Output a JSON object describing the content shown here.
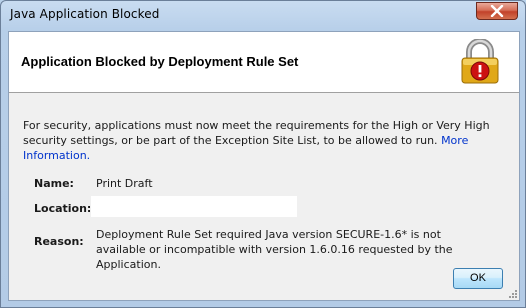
{
  "window": {
    "title": "Java Application Blocked"
  },
  "header": {
    "title": "Application Blocked by Deployment Rule Set",
    "icon": "padlock-warning-icon"
  },
  "message": {
    "text": "For security, applications must now meet the requirements for the High or Very High security settings, or be part of the Exception Site List, to be allowed to run.",
    "link": "More Information."
  },
  "details": {
    "name_label": "Name:",
    "name_value": "Print Draft",
    "location_label": "Location:",
    "location_value": "",
    "reason_label": "Reason:",
    "reason_value": "Deployment Rule Set required Java version SECURE-1.6* is not available or incompatible with version 1.6.0.16 requested by the Application."
  },
  "buttons": {
    "ok": "OK"
  },
  "colors": {
    "accent_link": "#0033cc",
    "close_button": "#c2422a",
    "lock_body": "#e0a818",
    "warning": "#cc1111"
  }
}
